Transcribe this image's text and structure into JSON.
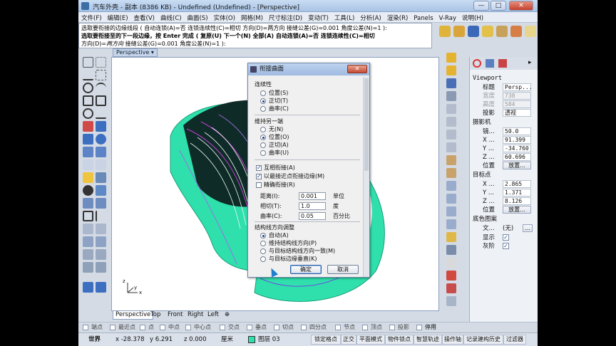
{
  "window": {
    "title": "汽车外壳 - 副本 (8386 KB) - Undefined (Undefined) - [Perspective]",
    "min": "—",
    "max": "□",
    "close": "✕"
  },
  "menu": [
    "文件(F)",
    "编辑(E)",
    "查看(V)",
    "曲线(C)",
    "曲面(S)",
    "实体(O)",
    "网格(M)",
    "尺寸标注(D)",
    "变动(T)",
    "工具(L)",
    "分析(A)",
    "渲染(R)",
    "Panels",
    "V-Ray",
    "说明(H)"
  ],
  "command": {
    "line1": "选取要衔接的边缘线段 ( 自动连锁(A)=否 连锁连续性(C)=相切 方向(D)=两方向 接缝公差(G)=0.001 角度公差(N)=1 ):",
    "line2": "选取要衔接至的下一段边缘，按 Enter 完成 ( 复原(U) 下一个(N) 全部(A) 自动连锁(A)=否 连锁连续性(C)=相切",
    "line3_prefix": "方向(D)=",
    "line3_italic": "两方向",
    "line3_rest": "  接缝公差(G)=0.001  角度公差(N)=1 ):"
  },
  "viewport": {
    "title": "Perspective",
    "dropdown": "▾",
    "tabs": [
      "Perspective",
      "Top",
      "Front",
      "Right",
      "Left",
      "⊕"
    ],
    "axis": {
      "x": "x",
      "y": "y",
      "z": "z"
    }
  },
  "dialog": {
    "title": "衔接曲面",
    "close": "✕",
    "continuity": {
      "heading": "连续性",
      "options": [
        "位置(S)",
        "正切(T)",
        "曲率(C)"
      ],
      "selected": 1
    },
    "other_end": {
      "heading": "维持另一端",
      "options": [
        "无(N)",
        "位置(O)",
        "正切(A)",
        "曲率(U)"
      ],
      "selected": 1
    },
    "checks": [
      {
        "label": "互相衔接(A)",
        "checked": true
      },
      {
        "label": "以最接近点衔接边缘(M)",
        "checked": true
      },
      {
        "label": "精确衔接(R)",
        "checked": false
      }
    ],
    "fields": [
      {
        "label": "距离(I):",
        "value": "0.001",
        "unit": "单位"
      },
      {
        "label": "相切(T):",
        "value": "1.0",
        "unit": "度"
      },
      {
        "label": "曲率(C):",
        "value": "0.05",
        "unit": "百分比"
      }
    ],
    "iso": {
      "heading": "结构线方向调整",
      "options": [
        "自动(A)",
        "维持结构线方向(P)",
        "与目标结构线方向一致(M)",
        "与目标边缘垂直(K)"
      ],
      "selected": 0
    },
    "ok": "确定",
    "cancel": "取消"
  },
  "panel": {
    "section": "Viewport",
    "rows": {
      "title_label": "标题",
      "title_value": "Persp...",
      "width_label": "宽度",
      "width_value": "738",
      "height_label": "高度",
      "height_value": "584",
      "proj_label": "投影",
      "proj_value": "透视"
    },
    "camera": {
      "heading": "摄影机",
      "lens_label": "镜...",
      "lens": "50.0",
      "x_label": "X ...",
      "x": "91.399",
      "y_label": "Y ...",
      "y": "-34.760",
      "z_label": "Z ...",
      "z": "60.696",
      "pos_label": "位置",
      "place": "放置..."
    },
    "target": {
      "heading": "目标点",
      "x_label": "X ...",
      "x": "2.865",
      "y_label": "Y ...",
      "y": "1.371",
      "z_label": "Z ...",
      "z": "8.126",
      "pos_label": "位置",
      "place": "放置..."
    },
    "bg": {
      "heading": "底色图案",
      "file_label": "文...",
      "file": "(无)",
      "more": "...",
      "show_label": "显示",
      "gray_label": "灰阶"
    }
  },
  "osnap": [
    "端点",
    "最近点",
    "点",
    "中点",
    "中心点",
    "交点",
    "垂点",
    "切点",
    "四分点",
    "节点",
    "顶点",
    "投影",
    "停用"
  ],
  "status": {
    "cplane": "世界",
    "x": "x -28.378",
    "y": "y 6.291",
    "z": "z 0.000",
    "unit": "厘米",
    "layer": "图层 03",
    "buttons": [
      "锁定格点",
      "正交",
      "平面模式",
      "物件锁点",
      "智慧轨迹",
      "操作轴",
      "记录建构历史",
      "过滤器"
    ]
  },
  "colors": {
    "surface": "#2fe0ad",
    "accent": "#1b3f8a"
  }
}
